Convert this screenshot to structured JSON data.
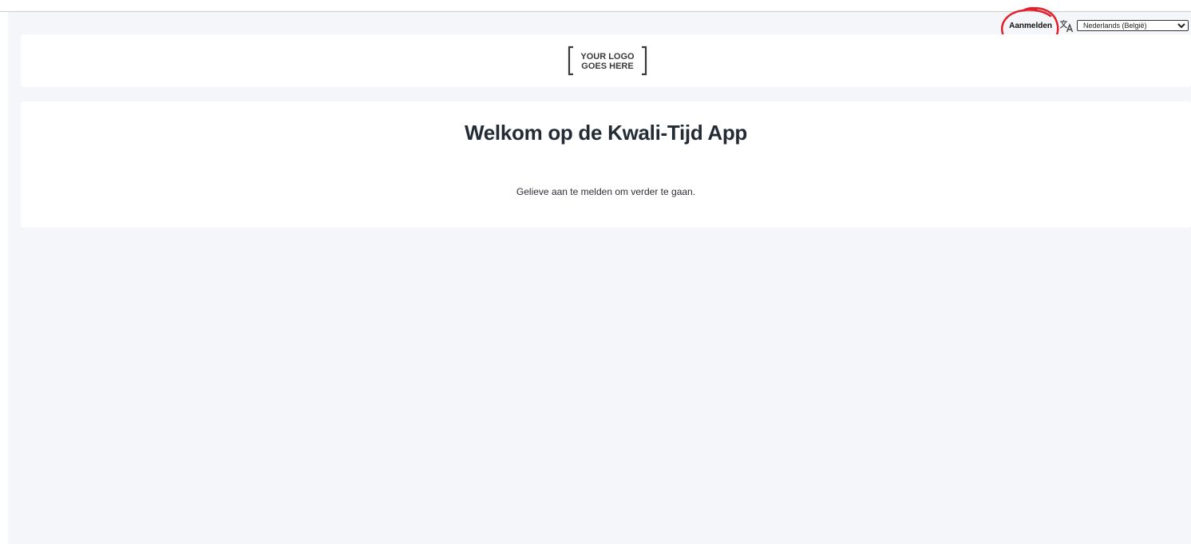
{
  "header": {
    "login_label": "Aanmelden",
    "language": {
      "selected": "Nederlands (België)",
      "options": [
        "Nederlands (België)"
      ]
    }
  },
  "logo": {
    "line1": "YOUR LOGO",
    "line2": "GOES HERE"
  },
  "main": {
    "title": "Welkom op de Kwali-Tijd App",
    "message": "Gelieve aan te melden om verder te gaan."
  },
  "colors": {
    "background": "#f5f6fa",
    "card": "#ffffff",
    "title_text": "#232c35",
    "annotation": "#e0202a"
  },
  "icons": {
    "language": "translate-icon",
    "dropdown": "chevron-down-icon"
  }
}
